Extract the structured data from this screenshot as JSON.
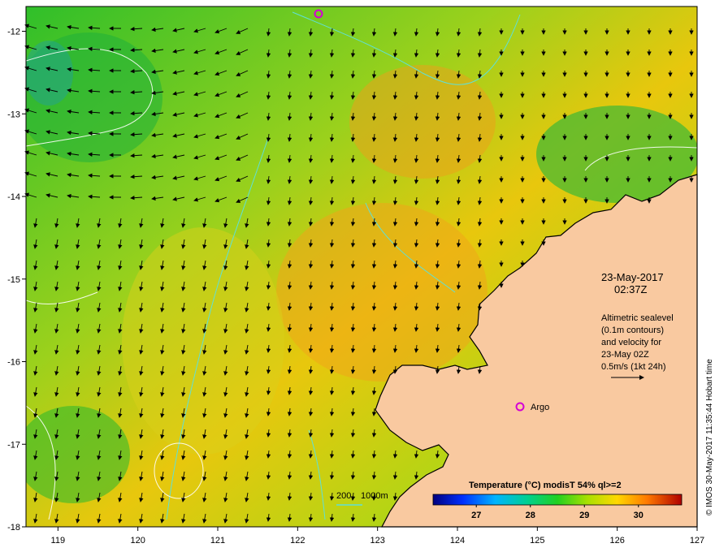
{
  "date_line": "23-May-2017",
  "time_line": "02:37Z",
  "info_lines": [
    "Altimetric sealevel",
    "(0.1m contours)",
    "and velocity for",
    "23-May 02Z",
    "0.5m/s (1kt 24h)"
  ],
  "argo_label": "Argo",
  "depth_legend": {
    "label_a": "200",
    "label_b": "1000m"
  },
  "colorbar": {
    "title": "Temperature (°C) modisT 54% ql>=2",
    "ticks": [
      "27",
      "28",
      "29",
      "30"
    ],
    "tick_values": [
      27,
      28,
      29,
      30
    ],
    "range": [
      26.2,
      30.8
    ]
  },
  "credit": "© IMOS 30-May-2017 11:35:44 Hobart time",
  "axes": {
    "lon_ticks": [
      119,
      120,
      121,
      122,
      123,
      124,
      125,
      126,
      127
    ],
    "lat_ticks": [
      -12,
      -13,
      -14,
      -15,
      -16,
      -17,
      -18
    ],
    "lon_range": [
      118.6,
      127.0
    ],
    "lat_range": [
      -18.0,
      -11.7
    ]
  },
  "colors": {
    "land": "#f9c9a0",
    "current_arrow": "#000000",
    "argo_marker": "#d400d4",
    "contour_200m": "#5fe0d8",
    "sealevel_contour": "#ffffff"
  }
}
